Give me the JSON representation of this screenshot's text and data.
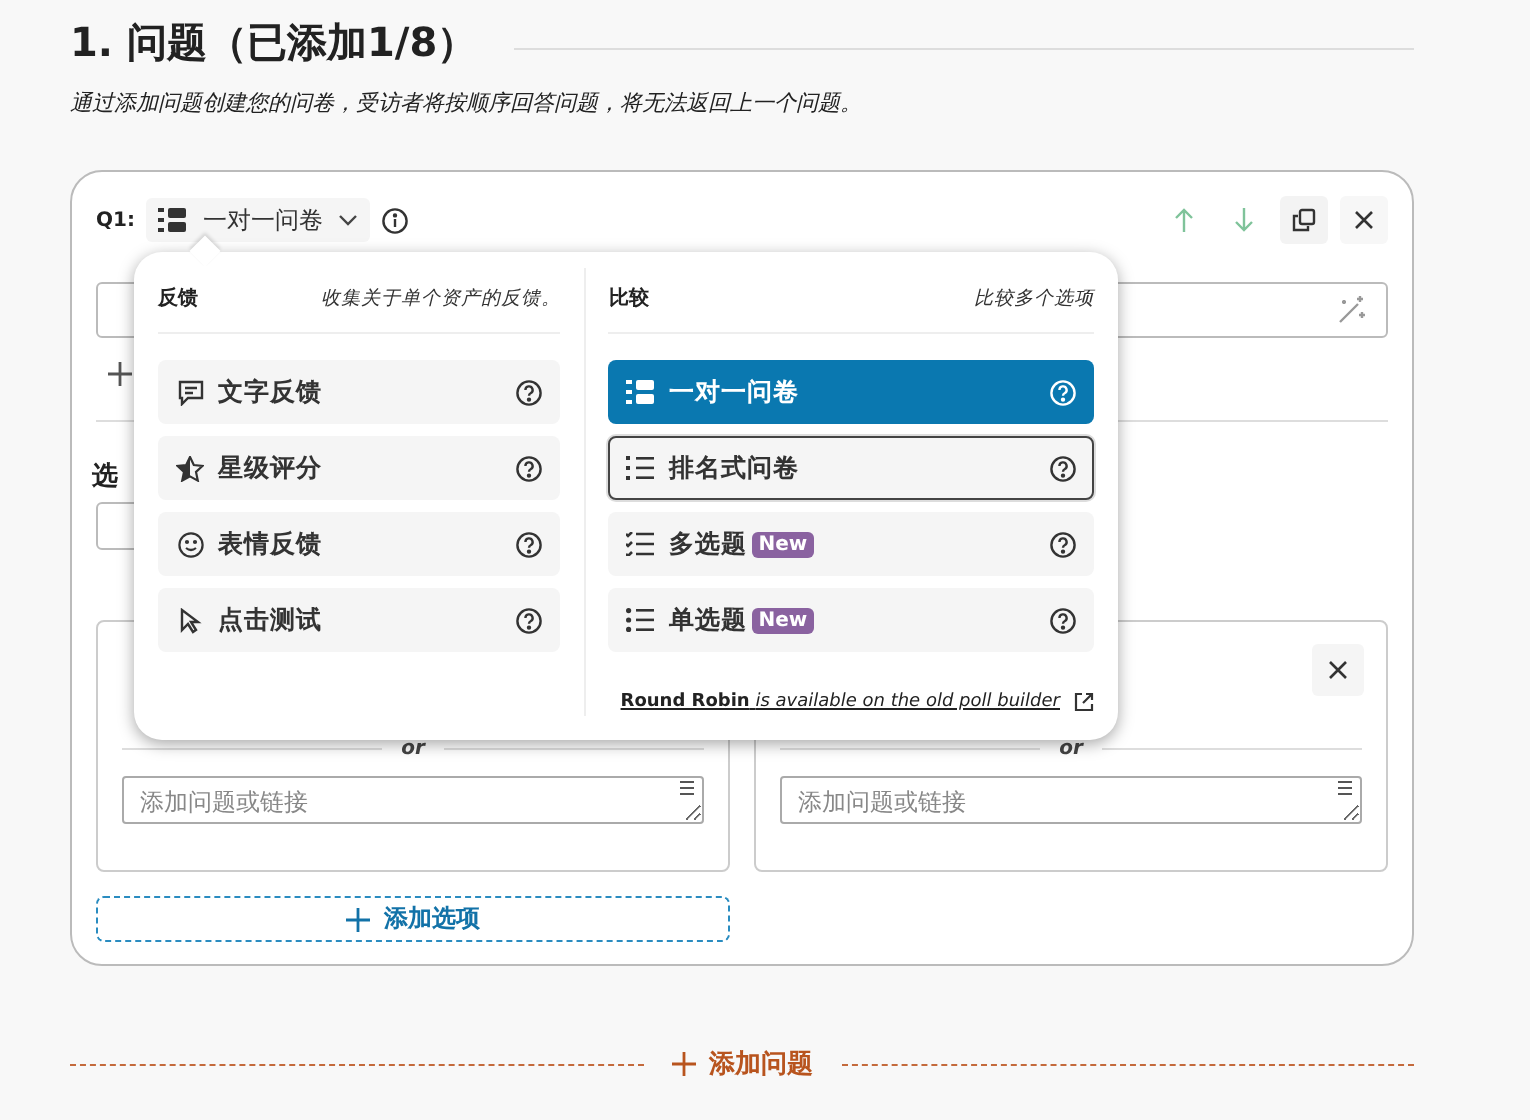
{
  "heading": "1. 问题（已添加1/8）",
  "subtitle": "通过添加问题创建您的问卷，受访者将按顺序回答问题，将无法返回上一个问题。",
  "question": {
    "label": "Q1:",
    "type": "一对一问卷"
  },
  "type_menu": {
    "columns": [
      {
        "title": "反馈",
        "description": "收集关于单个资产的反馈。",
        "items": [
          {
            "label": "文字反馈",
            "selected": false,
            "focused": false
          },
          {
            "label": "星级评分",
            "selected": false,
            "focused": false
          },
          {
            "label": "表情反馈",
            "selected": false,
            "focused": false
          },
          {
            "label": "点击测试",
            "selected": false,
            "focused": false
          }
        ]
      },
      {
        "title": "比较",
        "description": "比较多个选项",
        "items": [
          {
            "label": "一对一问卷",
            "selected": true,
            "focused": false
          },
          {
            "label": "排名式问卷",
            "selected": false,
            "focused": true
          },
          {
            "label": "多选题",
            "selected": false,
            "focused": false,
            "badge": "New"
          },
          {
            "label": "单选题",
            "selected": false,
            "focused": false,
            "badge": "New"
          }
        ]
      }
    ],
    "footer_link": "**Round Robin** *is available on the old poll builder*"
  },
  "options_label": "选",
  "option_cards": [
    {
      "divider_text": "or",
      "placeholder": "添加问题或链接"
    },
    {
      "divider_text": "or",
      "placeholder": "添加问题或链接",
      "closable": true
    }
  ],
  "add_option": "添加选项",
  "add_question": "添加问题"
}
